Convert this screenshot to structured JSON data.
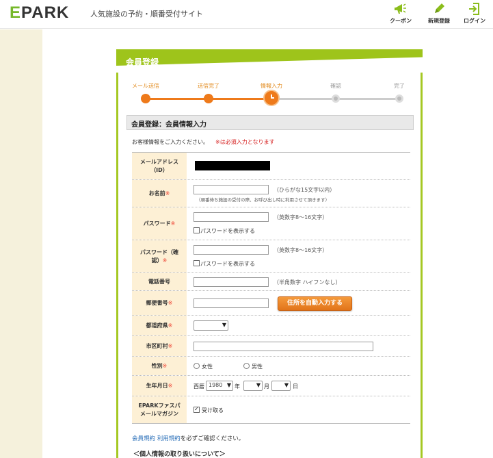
{
  "header": {
    "logo_e": "E",
    "logo_rest": "PARK",
    "tagline": "人気施設の予約・順番受付サイト",
    "nav": [
      {
        "label": "クーポン",
        "icon": "megaphone-icon"
      },
      {
        "label": "新規登録",
        "icon": "pencil-icon"
      },
      {
        "label": "ログイン",
        "icon": "login-icon"
      }
    ]
  },
  "card": {
    "title": "会員登録",
    "steps": [
      {
        "label": "メール送信",
        "state": "done"
      },
      {
        "label": "送信完了",
        "state": "done"
      },
      {
        "label": "情報入力",
        "state": "current"
      },
      {
        "label": "確認",
        "state": "todo"
      },
      {
        "label": "完了",
        "state": "todo"
      }
    ],
    "section_title": "会員登録：会員情報入力",
    "intro": "お客様情報をご入力ください。",
    "required_note": "※は必須入力となります"
  },
  "form": {
    "email_label_1": "メールアドレス",
    "email_label_2": "（ID）",
    "name_label": "お名前",
    "name_hint": "（ひらがな15文字以内）",
    "name_subhint": "（順番待ち施設の受付の際、お呼び出し時に利用させて頂きます）",
    "password_label": "パスワード",
    "password_hint": "（英数字8～16文字）",
    "show_password": "パスワードを表示する",
    "password_confirm_label_1": "パスワード（確",
    "password_confirm_label_2": "認）",
    "password_confirm_hint": "（英数字8～16文字）",
    "show_password_confirm": "パスワードを表示する",
    "phone_label": "電話番号",
    "phone_hint": "（半角数字 ハイフンなし）",
    "postal_label": "郵便番号",
    "auto_address_button": "住所を自動入力する",
    "prefecture_label": "都道府県",
    "city_label": "市区町村",
    "gender_label": "性別",
    "gender_options": [
      "女性",
      "男性"
    ],
    "birthday_label": "生年月日",
    "era": "西暦",
    "year_value": "1980",
    "year_unit": "年",
    "month_unit": "月",
    "day_unit": "日",
    "mail_label_1": "EPARKファスパ",
    "mail_label_2": "メールマガジン",
    "mail_option": "受け取る",
    "mail_checked": true,
    "required_mark": "※"
  },
  "footer": {
    "terms_link_1": "会員規約",
    "terms_link_2": "利用規約",
    "terms_text": "を必ずご確認ください。",
    "privacy_heading": "＜個人情報の取り扱いについて＞"
  },
  "colors": {
    "brand_green": "#9ec41b",
    "accent_orange": "#ee7a1b",
    "required_red": "#d62020",
    "label_bg": "#fdf0d5"
  }
}
